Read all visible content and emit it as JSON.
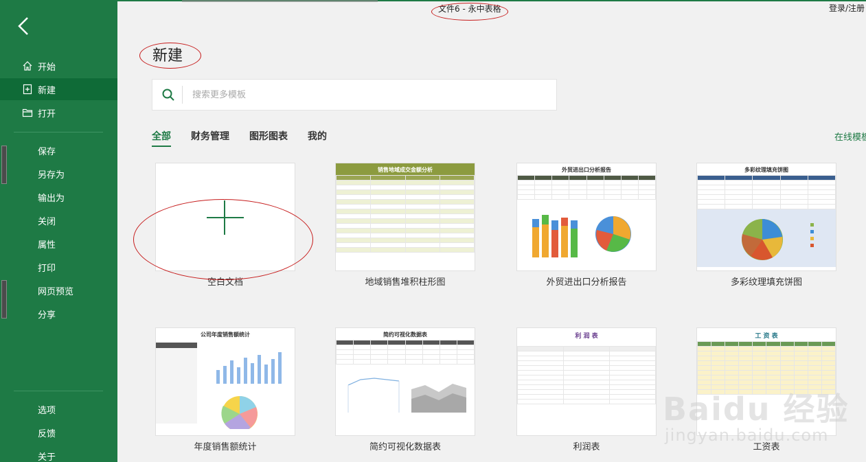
{
  "window": {
    "title": "文件6 - 永中表格",
    "login": "登录/注册"
  },
  "sidebar": {
    "top_items": [
      {
        "label": "开始",
        "icon": "home-icon"
      },
      {
        "label": "新建",
        "icon": "new-doc-icon",
        "active": true
      },
      {
        "label": "打开",
        "icon": "folder-icon"
      }
    ],
    "middle_items": [
      "保存",
      "另存为",
      "输出为",
      "关闭",
      "属性",
      "打印",
      "网页预览",
      "分享"
    ],
    "bottom_items": [
      "选项",
      "反馈",
      "关于"
    ]
  },
  "main": {
    "title": "新建",
    "search": {
      "placeholder": "搜索更多模板"
    },
    "tabs": [
      "全部",
      "财务管理",
      "图形图表",
      "我的"
    ],
    "online_link": "在线模板",
    "templates": [
      {
        "label": "空白文档"
      },
      {
        "label": "地域销售堆积柱形图",
        "title": "销售地域成交金额分析"
      },
      {
        "label": "外贸进出口分析报告",
        "title": "外贸进出口分析报告"
      },
      {
        "label": "多彩纹理填充饼图",
        "title": "多彩纹理填充饼图"
      },
      {
        "label": "年度销售额统计",
        "title": "公司年度销售额统计"
      },
      {
        "label": "简约可视化数据表",
        "title": "简约可视化数据表"
      },
      {
        "label": "利润表",
        "title": "利 润 表"
      },
      {
        "label": "工资表",
        "title": "工 资 表"
      }
    ]
  },
  "watermark": {
    "main": "Baidu 经验",
    "sub": "jingyan.baidu.com"
  },
  "colors": {
    "sidebar": "#1e7a45",
    "active": "#0f6b37",
    "accent": "#1e7a45",
    "annotation": "#c61b1b"
  }
}
